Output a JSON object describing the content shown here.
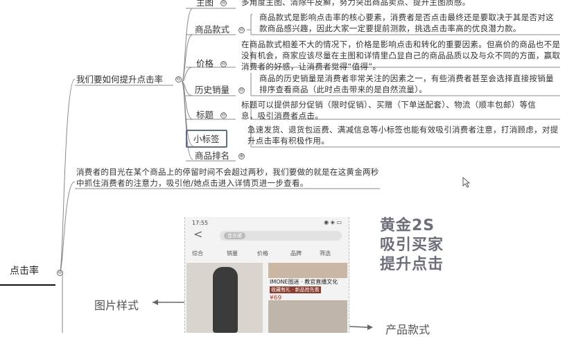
{
  "mindmap": {
    "root": {
      "label": "点击率"
    },
    "branch": {
      "label": "我们要如何提升点击率"
    },
    "summary": "消费者的目光在某个商品上的停留时间不会超过两秒，我们要做的就是在这黄金两秒中抓住消费者的注意力，吸引他/她点击进入详情页进一步查看。",
    "nodes": [
      {
        "label": "主图",
        "desc": "多角度主图、清除牛皮癣，努力突出商品卖点、提升主图质感。"
      },
      {
        "label": "商品款式",
        "desc": "商品款式是影响点击率的核心要素，消费者是否点击最终还是要取决于其是否对这款商品感兴趣，因此大家一定要提前测款，挑选点击率高的优良潜力款。"
      },
      {
        "label": "价格",
        "desc": "在商品款式相差不大的情况下，价格是影响点击和转化的重要因素。但高价的商品也不是没有机会，商家应该尽量在主图和详情里凸显自己的商品品质以及与众不同的方面，赢取消费者的好感，让消费者觉得“值得”。"
      },
      {
        "label": "历史销量",
        "desc": "商品的历史销量是消费者非常关注的因素之一，有些消费者甚至会选择直接按销量排序查看商品（此时点击带来的是自然流量）。"
      },
      {
        "label": "标题",
        "desc": "标题可以提供部分促销（限时促销）、买赠（下单送配套）、物流（顺丰包邮）等信息，吸引消费者点击。"
      },
      {
        "label": "小标签",
        "desc": "急速发货、退货包运费、满减信息等小标签也能有效吸引消费者注意，打消顾虑，对提升点击率有积极作用。"
      },
      {
        "label": "商品排名",
        "desc": ""
      }
    ],
    "toggle_minus": "⊖",
    "toggle_plus": "⊕"
  },
  "phone": {
    "time": "17:55",
    "status_right": "◉ ◈ ▭",
    "back": "<",
    "search_tag": "连衣裙",
    "filters": [
      "综合",
      "销量",
      "价格",
      "品牌",
      "筛选"
    ],
    "shop_name": "IMONE图迷 · 教官直播文化",
    "shop_sub": "收藏有礼 · 新品抢先看",
    "price": "¥69"
  },
  "annotations": {
    "headline": [
      "黄金2S",
      "吸引买家",
      "提升点击"
    ],
    "image_style": "图片样式",
    "product_style": "产品款式"
  },
  "colors": {
    "line": "#888888",
    "selection": "#5a6e8a",
    "headline": "#6b6f7a"
  }
}
